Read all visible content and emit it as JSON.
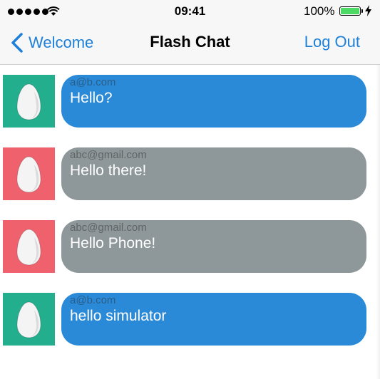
{
  "status_bar": {
    "time": "09:41",
    "battery_percent": "100%",
    "signal_dots": 5,
    "battery_level": 1.0
  },
  "nav": {
    "back_label": "Welcome",
    "title": "Flash Chat",
    "logout_label": "Log Out"
  },
  "colors": {
    "tint": "#1d7fd8",
    "bubble_blue": "#2b8ad8",
    "bubble_gray": "#8e979a",
    "avatar_green": "#23ae8e",
    "avatar_red": "#f0616e"
  },
  "messages": [
    {
      "sender": "a@b.com",
      "text": "Hello?",
      "bubble_color": "#2b8ad8",
      "avatar_color": "#23ae8e",
      "avatar_icon": "egg-icon"
    },
    {
      "sender": "abc@gmail.com",
      "text": "Hello there!",
      "bubble_color": "#8e979a",
      "avatar_color": "#f0616e",
      "avatar_icon": "egg-icon"
    },
    {
      "sender": "abc@gmail.com",
      "text": " Hello Phone!",
      "bubble_color": "#8e979a",
      "avatar_color": "#f0616e",
      "avatar_icon": "egg-icon"
    },
    {
      "sender": "a@b.com",
      "text": "hello simulator",
      "bubble_color": "#2b8ad8",
      "avatar_color": "#23ae8e",
      "avatar_icon": "egg-icon"
    }
  ]
}
